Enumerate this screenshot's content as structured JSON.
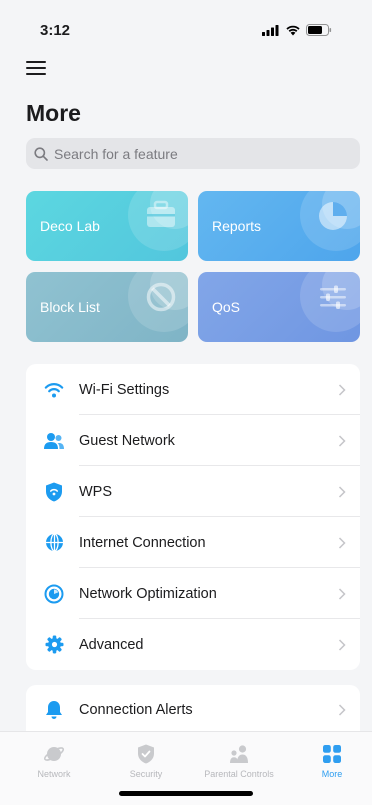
{
  "status_bar": {
    "time": "3:12"
  },
  "header": {
    "title": "More"
  },
  "search": {
    "placeholder": "Search for a feature"
  },
  "tiles": [
    {
      "label": "Deco Lab",
      "icon": "briefcase-icon",
      "color": "#5cd7e0"
    },
    {
      "label": "Reports",
      "icon": "pie-chart-icon",
      "color": "#63b7f0"
    },
    {
      "label": "Block List",
      "icon": "block-icon",
      "color": "#90c2d1"
    },
    {
      "label": "QoS",
      "icon": "sliders-icon",
      "color": "#82a6e8"
    }
  ],
  "settings_list": [
    {
      "label": "Wi-Fi Settings",
      "icon": "wifi-icon"
    },
    {
      "label": "Guest Network",
      "icon": "guest-icon"
    },
    {
      "label": "WPS",
      "icon": "wps-shield-icon"
    },
    {
      "label": "Internet Connection",
      "icon": "globe-icon"
    },
    {
      "label": "Network Optimization",
      "icon": "optimization-icon"
    },
    {
      "label": "Advanced",
      "icon": "gear-icon"
    }
  ],
  "alerts_list": [
    {
      "label": "Connection Alerts",
      "icon": "bell-icon"
    }
  ],
  "tab_bar": {
    "tabs": [
      {
        "label": "Network",
        "icon": "network-planet-icon",
        "active": false
      },
      {
        "label": "Security",
        "icon": "security-shield-icon",
        "active": false
      },
      {
        "label": "Parental Controls",
        "icon": "parental-controls-icon",
        "active": false
      },
      {
        "label": "More",
        "icon": "more-grid-icon",
        "active": true
      }
    ]
  },
  "colors": {
    "accent": "#2f9ef0",
    "icon_blue": "#1c9bf0",
    "background": "#f4f5f7"
  }
}
